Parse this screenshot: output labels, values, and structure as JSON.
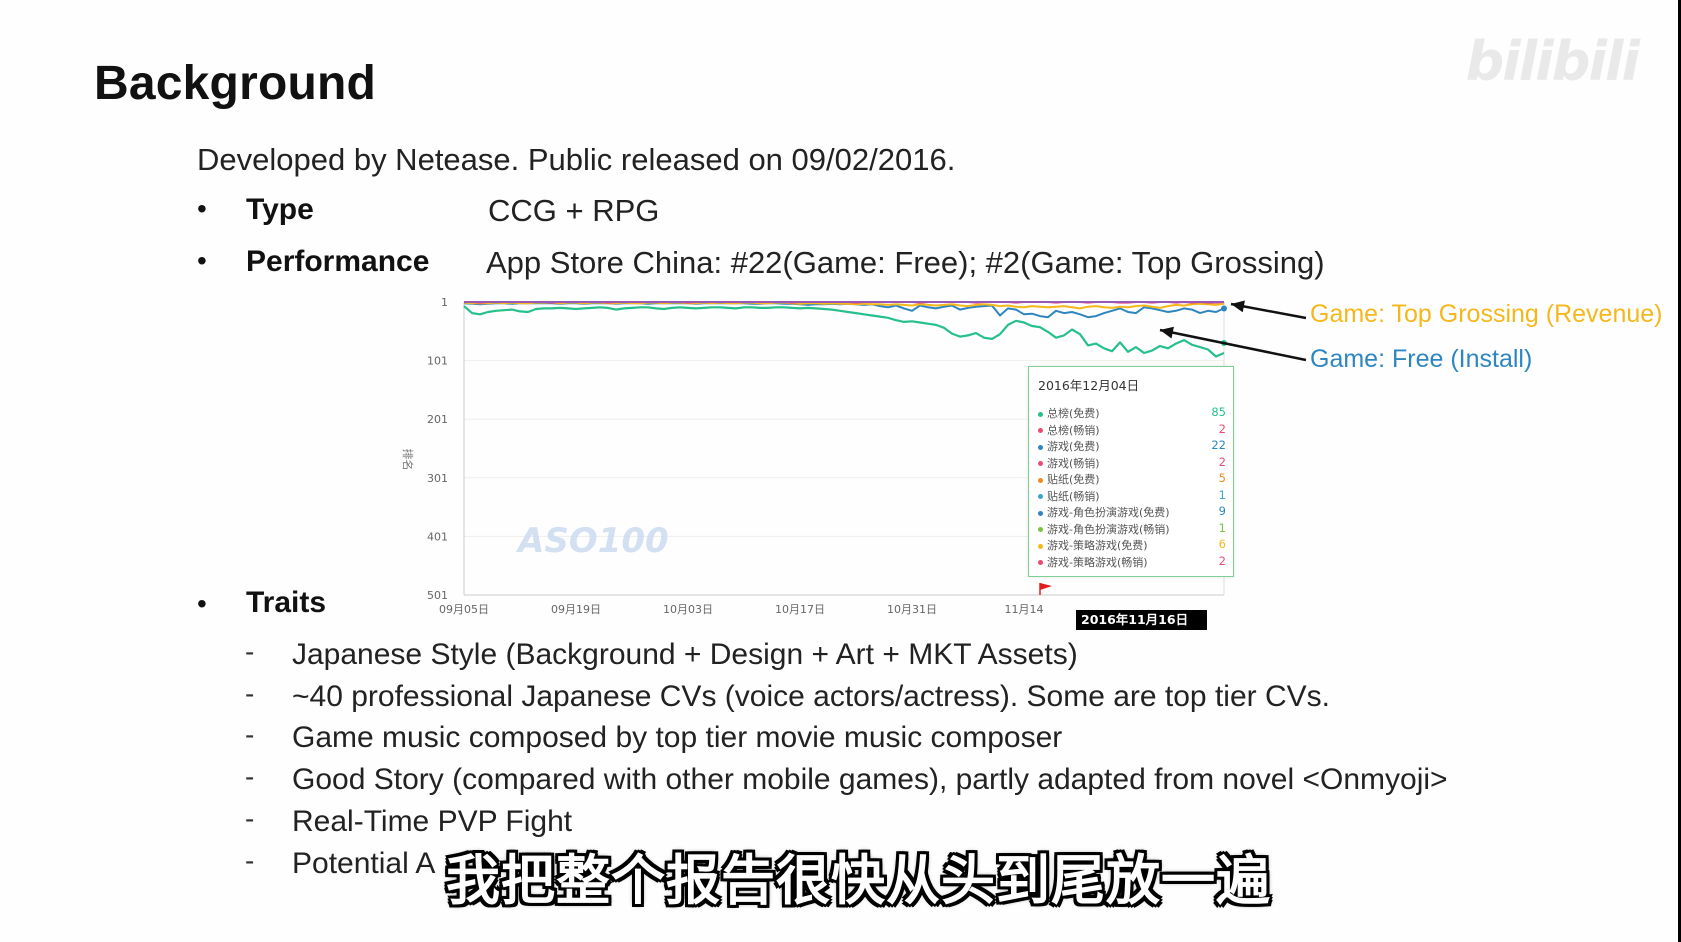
{
  "slide": {
    "title": "Background",
    "watermark": "bilibili",
    "intro": "Developed by Netease. Public released on 09/02/2016.",
    "type_label": "Type",
    "type_value": "CCG + RPG",
    "performance_label": "Performance",
    "performance_value": "App Store China: #22(Game: Free); #2(Game: Top Grossing)",
    "traits_label": "Traits",
    "bullet_glyph": "•",
    "dash_glyph": "-",
    "traits": [
      "Japanese Style (Background + Design + Art + MKT Assets)",
      "~40 professional Japanese CVs (voice actors/actress). Some are top tier CVs.",
      "Game music composed by top tier movie music composer",
      "Good Story (compared with other mobile games), partly adapted from novel <Onmyoji>",
      "Real-Time PVP Fight",
      "Potential A"
    ]
  },
  "callouts": {
    "grossing": "Game: Top Grossing (Revenue)",
    "free": "Game: Free (Install)",
    "grossing_color": "#f5b81c",
    "free_color": "#2e86c1"
  },
  "subtitle": "我把整个报告很快从头到尾放一遍",
  "chart_data": {
    "type": "line",
    "ylabel": "排名",
    "y_reversed": true,
    "y_ticks": [
      1,
      101,
      201,
      301,
      401,
      501
    ],
    "ylim": [
      1,
      501
    ],
    "x_ticks": [
      "09月05日",
      "09月19日",
      "10月03日",
      "10月17日",
      "10月31日",
      "11月14"
    ],
    "x_tick_index": [
      0,
      14,
      28,
      42,
      56,
      70
    ],
    "brand_watermark": "ASO100",
    "highlight_date": "2016年11月16日",
    "grid": true,
    "series": [
      {
        "color": "#26c08a",
        "values": [
          8,
          20,
          22,
          18,
          16,
          15,
          14,
          17,
          18,
          13,
          12,
          12,
          11,
          12,
          13,
          12,
          11,
          10,
          11,
          14,
          12,
          11,
          10,
          10,
          12,
          13,
          11,
          10,
          11,
          12,
          11,
          10,
          10,
          11,
          12,
          10,
          10,
          11,
          11,
          10,
          10,
          11,
          12,
          11,
          12,
          13,
          14,
          16,
          18,
          20,
          22,
          24,
          26,
          28,
          32,
          35,
          34,
          36,
          38,
          40,
          45,
          55,
          60,
          58,
          54,
          62,
          64,
          56,
          40,
          33,
          36,
          42,
          44,
          52,
          62,
          58,
          48,
          56,
          75,
          72,
          80,
          85,
          70,
          86,
          78,
          88,
          84,
          76,
          80,
          72,
          66,
          74,
          78,
          82,
          94,
          88
        ]
      },
      {
        "color": "#2e86c1",
        "values": [
          3,
          4,
          5,
          4,
          3,
          3,
          4,
          3,
          3,
          3,
          3,
          3,
          4,
          3,
          3,
          4,
          3,
          3,
          3,
          4,
          3,
          3,
          3,
          4,
          3,
          3,
          3,
          3,
          3,
          4,
          3,
          3,
          3,
          3,
          3,
          3,
          4,
          4,
          3,
          3,
          4,
          4,
          5,
          6,
          5,
          5,
          4,
          5,
          4,
          5,
          6,
          5,
          8,
          10,
          7,
          12,
          16,
          7,
          10,
          12,
          9,
          7,
          14,
          11,
          9,
          8,
          7,
          24,
          12,
          14,
          22,
          21,
          25,
          27,
          16,
          20,
          18,
          22,
          27,
          25,
          20,
          16,
          12,
          18,
          20,
          10,
          12,
          15,
          18,
          16,
          12,
          14,
          20,
          16,
          18,
          12
        ]
      },
      {
        "color": "#f5b81c",
        "values": [
          2,
          3,
          3,
          3,
          2,
          3,
          2,
          3,
          3,
          2,
          2,
          2,
          3,
          2,
          2,
          3,
          2,
          2,
          3,
          3,
          2,
          3,
          3,
          2,
          2,
          3,
          2,
          2,
          3,
          3,
          2,
          3,
          2,
          3,
          3,
          2,
          2,
          3,
          3,
          2,
          2,
          3,
          4,
          3,
          3,
          4,
          3,
          4,
          4,
          5,
          4,
          5,
          5,
          6,
          5,
          6,
          7,
          5,
          6,
          7,
          6,
          5,
          7,
          8,
          6,
          5,
          6,
          8,
          7,
          9,
          10,
          8,
          9,
          10,
          9,
          8,
          10,
          12,
          9,
          8,
          10,
          11,
          9,
          10,
          8,
          7,
          9,
          11,
          8,
          6,
          7,
          5,
          4,
          5,
          6,
          4
        ]
      },
      {
        "color": "#e84c74",
        "values": [
          1,
          1,
          2,
          1,
          1,
          1,
          1,
          1,
          1,
          1,
          1,
          2,
          1,
          1,
          1,
          1,
          1,
          1,
          2,
          1,
          1,
          1,
          1,
          1,
          1,
          1,
          1,
          1,
          2,
          1,
          1,
          1,
          1,
          1,
          1,
          1,
          1,
          1,
          1,
          1,
          1,
          2,
          1,
          1,
          1,
          1,
          1,
          1,
          1,
          2,
          1,
          1,
          1,
          1,
          1,
          1,
          1,
          2,
          1,
          1,
          1,
          1,
          1,
          1,
          2,
          1,
          1,
          1,
          1,
          2,
          1,
          1,
          1,
          1,
          2,
          1,
          1,
          1,
          2,
          1,
          1,
          1,
          2,
          2,
          1,
          1,
          2,
          1,
          1,
          2,
          1,
          2,
          1,
          2,
          2,
          1
        ]
      },
      {
        "color": "#9b59b6",
        "values": [
          1,
          1,
          1,
          1,
          1,
          1,
          1,
          1,
          1,
          1,
          1,
          1,
          1,
          1,
          1,
          1,
          1,
          1,
          1,
          1,
          1,
          1,
          1,
          1,
          1,
          1,
          1,
          1,
          1,
          1,
          1,
          1,
          1,
          1,
          1,
          1,
          1,
          1,
          1,
          1,
          1,
          1,
          1,
          1,
          1,
          1,
          1,
          1,
          1,
          1,
          1,
          1,
          1,
          1,
          1,
          1,
          1,
          1,
          1,
          1,
          1,
          1,
          1,
          1,
          1,
          1,
          1,
          1,
          1,
          1,
          1,
          1,
          1,
          1,
          1,
          1,
          1,
          1,
          1,
          1,
          1,
          1,
          1,
          1,
          1,
          1,
          1,
          1,
          1,
          1,
          1,
          1,
          1,
          1,
          1,
          1
        ]
      }
    ],
    "tooltip": {
      "date": "2016年12月04日",
      "rows": [
        {
          "label": "总榜(免费)",
          "value": "85",
          "dot": "#26c08a",
          "value_color": "#26c08a"
        },
        {
          "label": "总榜(畅销)",
          "value": "2",
          "dot": "#e84c74",
          "value_color": "#e84c74"
        },
        {
          "label": "游戏(免费)",
          "value": "22",
          "dot": "#2e86c1",
          "value_color": "#2e86c1"
        },
        {
          "label": "游戏(畅销)",
          "value": "2",
          "dot": "#e84c74",
          "value_color": "#e84c74"
        },
        {
          "label": "贴纸(免费)",
          "value": "5",
          "dot": "#f08a24",
          "value_color": "#f08a24"
        },
        {
          "label": "贴纸(畅销)",
          "value": "1",
          "dot": "#3aa6c9",
          "value_color": "#3aa6c9"
        },
        {
          "label": "游戏-角色扮演游戏(免费)",
          "value": "9",
          "dot": "#2e86c1",
          "value_color": "#2e86c1"
        },
        {
          "label": "游戏-角色扮演游戏(畅销)",
          "value": "1",
          "dot": "#7cc242",
          "value_color": "#7cc242"
        },
        {
          "label": "游戏-策略游戏(免费)",
          "value": "6",
          "dot": "#f5b81c",
          "value_color": "#f5b81c"
        },
        {
          "label": "游戏-策略游戏(畅销)",
          "value": "2",
          "dot": "#e84c74",
          "value_color": "#e84c74"
        }
      ]
    }
  }
}
